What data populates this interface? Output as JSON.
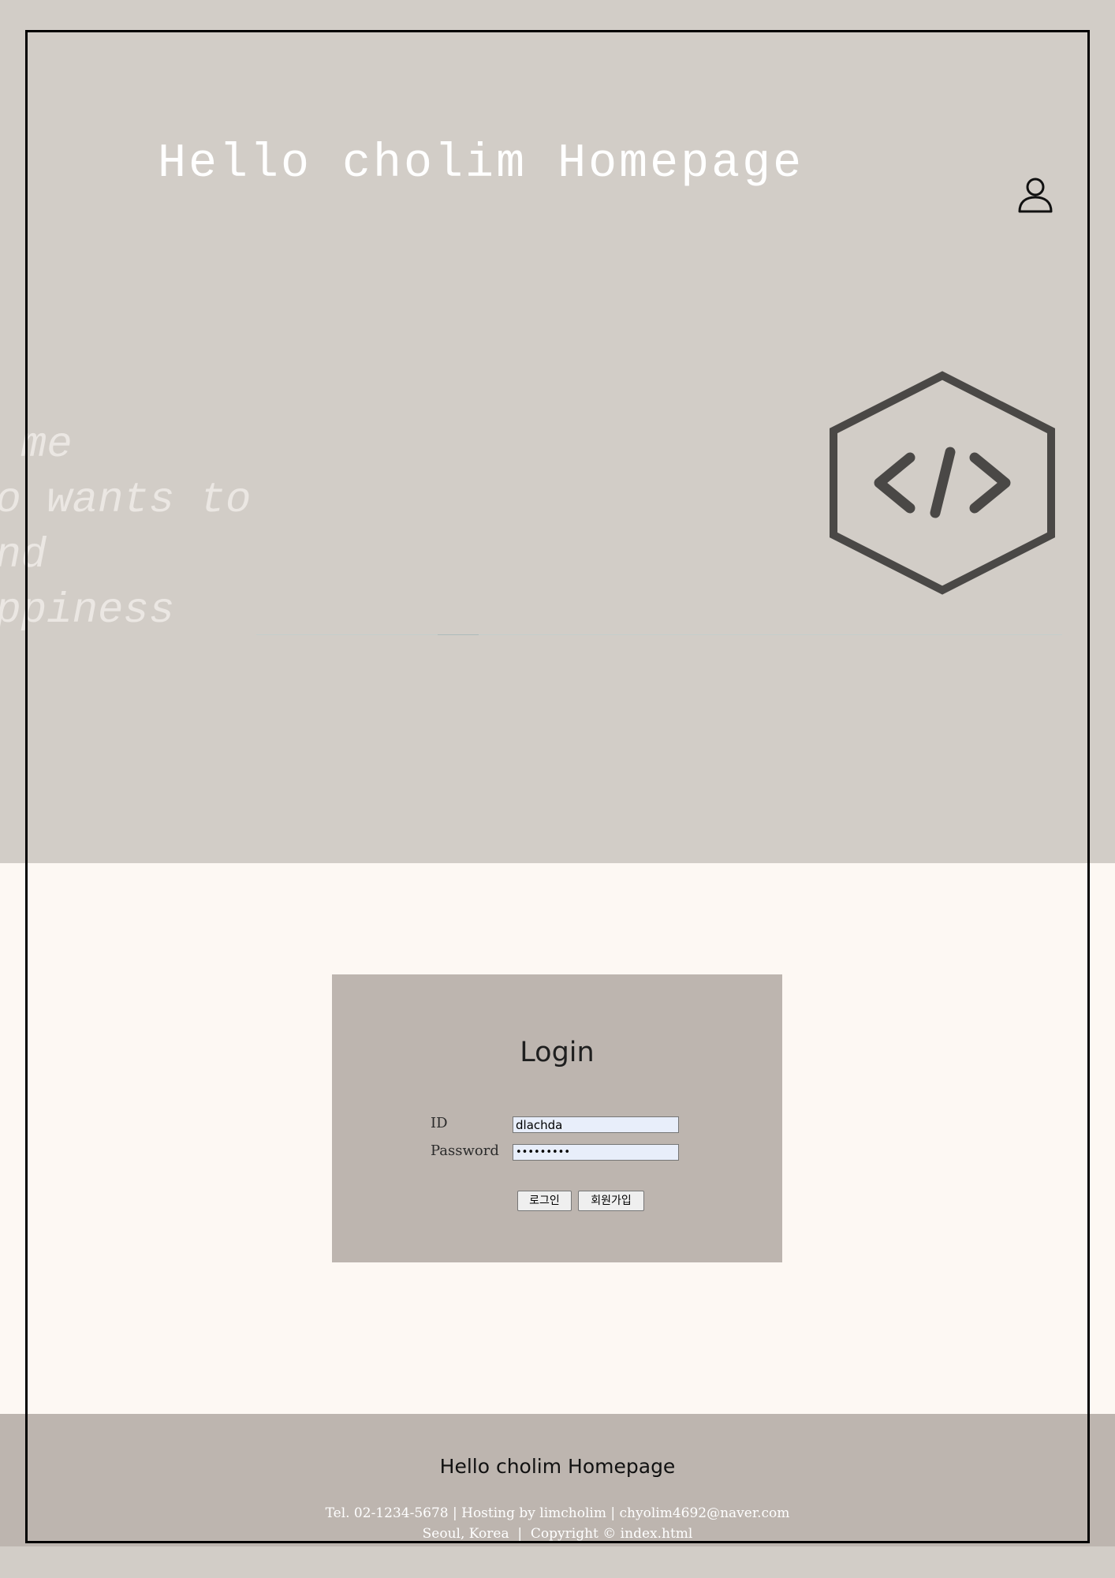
{
  "header": {
    "site_title": "Hello cholim Homepage"
  },
  "hero": {
    "tagline": "o me\nho wants to\nind\nappiness",
    "logo_icon": "code-hexagon-icon",
    "user_icon": "user-icon"
  },
  "login": {
    "heading": "Login",
    "id_label": "ID",
    "password_label": "Password",
    "id_value": "dlachda",
    "password_value": "123456789",
    "login_button": "로그인",
    "signup_button": "회원가입"
  },
  "footer": {
    "title": "Hello cholim Homepage",
    "contact_line": "Tel. 02-1234-5678 | Hosting by limcholim | chyolim4692@naver.com",
    "copyright_line": "Seoul, Korea  |  Copyright © index.html"
  },
  "colors": {
    "hero_background": "#d2cdc7",
    "content_background": "#fdf8f3",
    "panel_background": "#bdb5af",
    "footer_background": "#bdb5af",
    "logo_stroke": "#4a4846"
  }
}
